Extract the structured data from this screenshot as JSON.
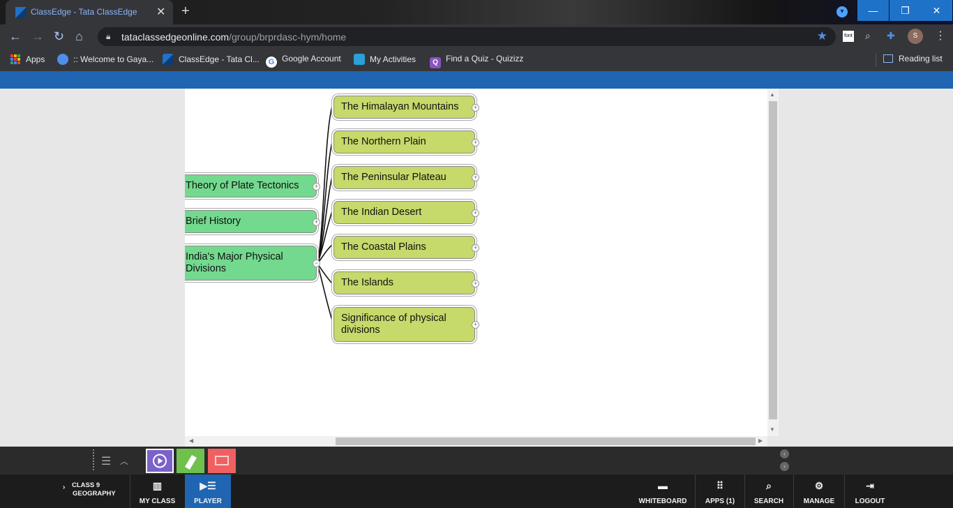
{
  "browser": {
    "tab_title": "ClassEdge - Tata ClassEdge",
    "url_host": "tataclassedgeonline.com",
    "url_path": "/group/brprdasc-hym/home",
    "avatar_letter": "S",
    "font_ext_label": "font",
    "bookmarks": [
      {
        "label": "Apps",
        "icon_color": "#e94235"
      },
      {
        "label": ":: Welcome to Gaya...",
        "icon_color": "#4f8fe8"
      },
      {
        "label": "ClassEdge - Tata Cl...",
        "icon_color": "#1e72c8"
      },
      {
        "label": "Google Account",
        "icon_color": "#ffffff"
      },
      {
        "label": "My Activities",
        "icon_color": "#2aa0d8"
      },
      {
        "label": "Find a Quiz - Quizizz",
        "icon_color": "#8854c0"
      }
    ],
    "reading_list": "Reading list"
  },
  "mindmap": {
    "left_nodes": [
      {
        "label": "Theory of Plate Tectonics"
      },
      {
        "label": "Brief History"
      },
      {
        "label": "India's Major Physical Divisions"
      }
    ],
    "right_nodes": [
      {
        "label": "The Himalayan Mountains"
      },
      {
        "label": "The Northern Plain"
      },
      {
        "label": "The Peninsular Plateau"
      },
      {
        "label": "The Indian Desert"
      },
      {
        "label": "The Coastal Plains"
      },
      {
        "label": "The Islands"
      },
      {
        "label": "Significance of physical divisions"
      }
    ]
  },
  "footer": {
    "class_line1": "CLASS 9",
    "class_line2": "GEOGRAPHY",
    "nav": [
      {
        "label": "MY CLASS",
        "icon": "books-icon"
      },
      {
        "label": "PLAYER",
        "icon": "player-icon"
      },
      {
        "label": "WHITEBOARD",
        "icon": "whiteboard-icon"
      },
      {
        "label": "APPS (1)",
        "icon": "apps-grid-icon"
      },
      {
        "label": "SEARCH",
        "icon": "search-icon"
      },
      {
        "label": "MANAGE",
        "icon": "manage-icon"
      },
      {
        "label": "LOGOUT",
        "icon": "logout-icon"
      }
    ]
  },
  "colors": {
    "brand_blue": "#1f65b1",
    "node_green": "#73d98e",
    "node_lime": "#c6d96b",
    "active_nav": "#1f65b1"
  }
}
